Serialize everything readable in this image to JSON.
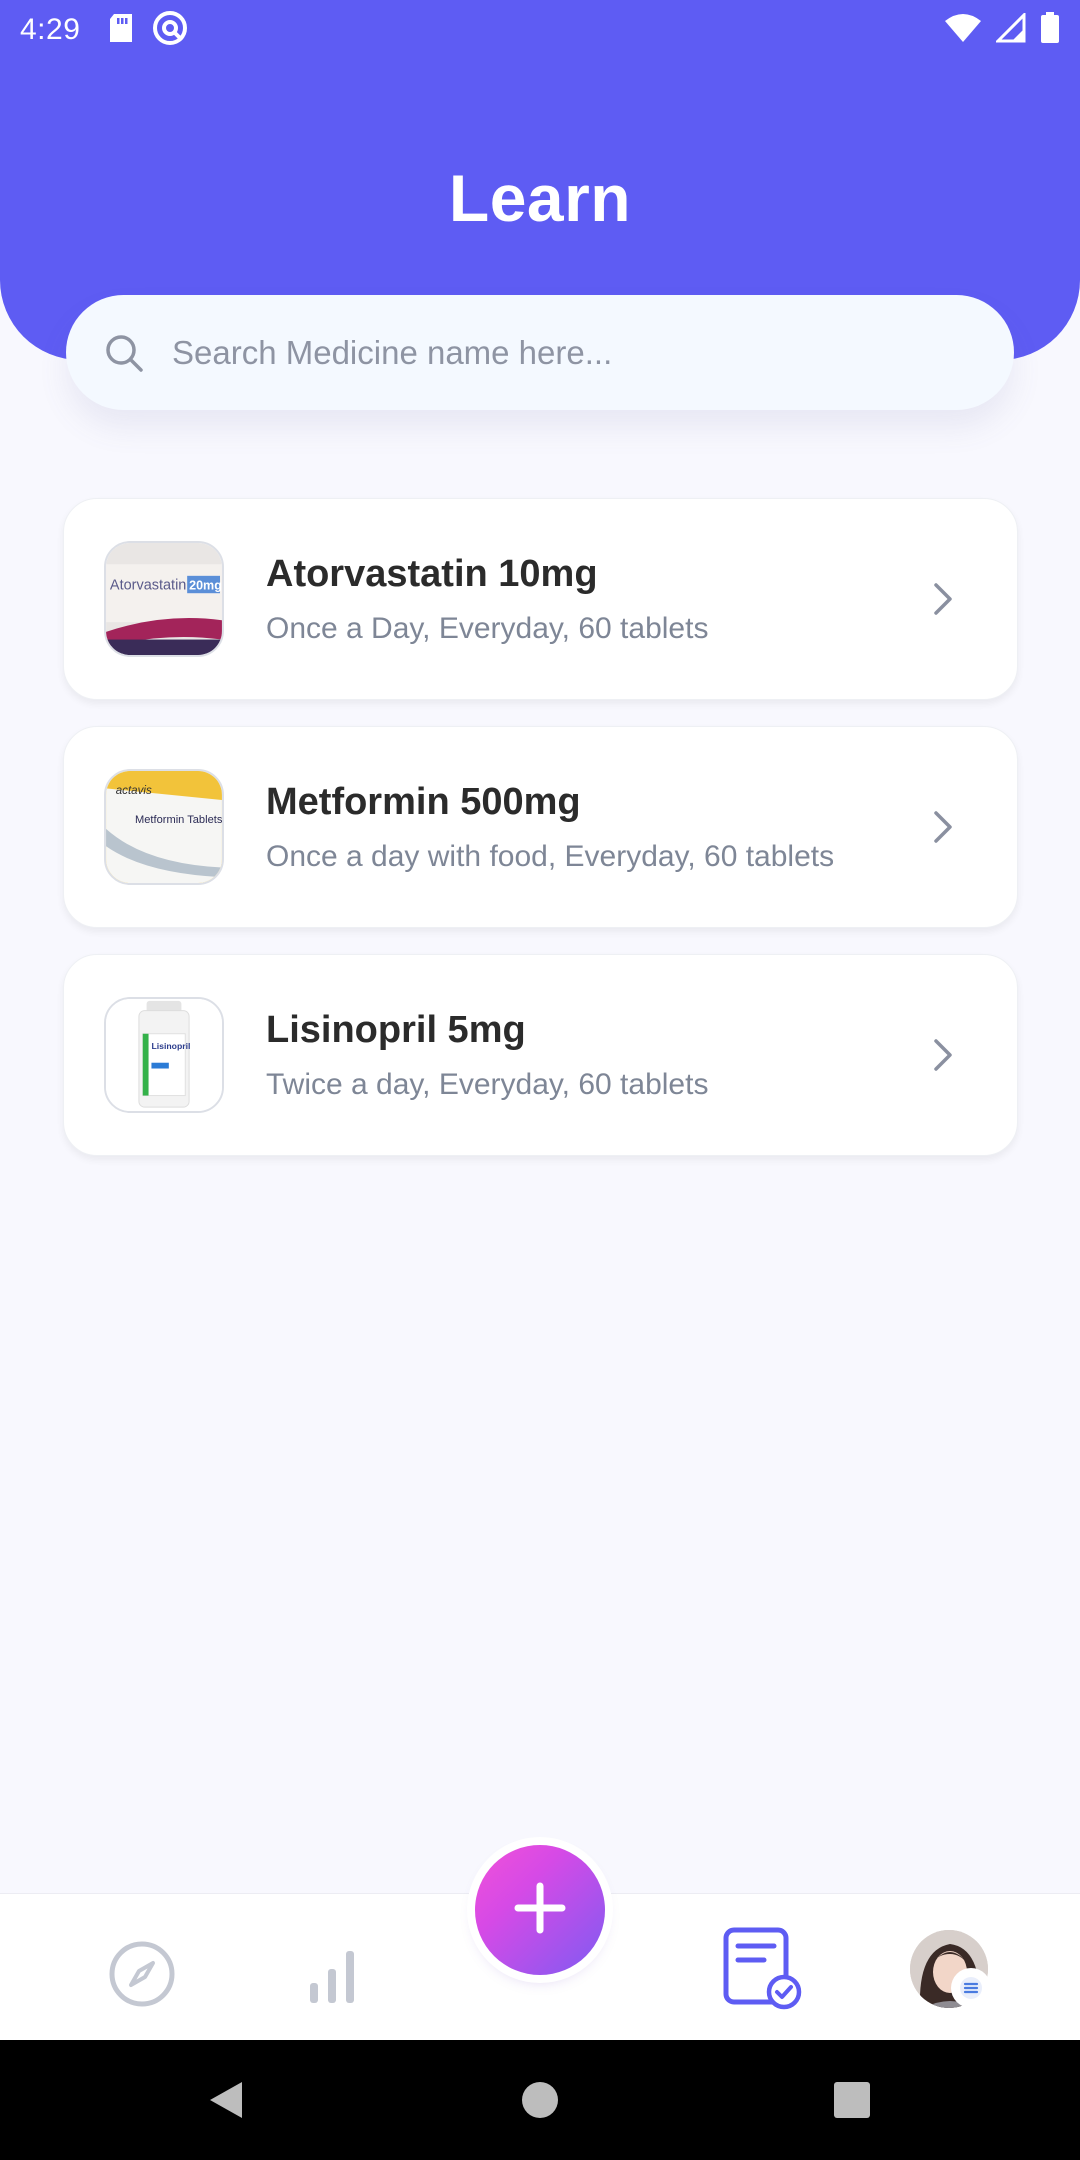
{
  "status_bar": {
    "time": "4:29",
    "icons_left": [
      "sd-card-icon",
      "do-not-disturb-icon"
    ],
    "icons_right": [
      "wifi-icon",
      "signal-icon",
      "battery-icon"
    ]
  },
  "header": {
    "title": "Learn"
  },
  "search": {
    "placeholder": "Search Medicine name here...",
    "value": "",
    "icon": "search-icon"
  },
  "medicines": [
    {
      "name": "Atorvastatin 10mg",
      "schedule": "Once a Day, Everyday, 60 tablets",
      "thumb_label": "Atorvastatin",
      "thumb_badge": "20mg"
    },
    {
      "name": "Metformin 500mg",
      "schedule": "Once a day with food, Everyday, 60 tablets",
      "thumb_label": "Metformin Tablets",
      "thumb_brand": "actavis"
    },
    {
      "name": "Lisinopril 5mg",
      "schedule": "Twice a day, Everyday, 60 tablets",
      "thumb_label": "Lisinopril"
    }
  ],
  "bottom_nav": {
    "items": [
      "compass-icon",
      "stats-icon",
      "add-icon",
      "prescription-icon",
      "avatar"
    ],
    "active": "prescription-icon"
  },
  "colors": {
    "primary": "#5E5CF3",
    "fab_start": "#F251D8",
    "fab_end": "#7E5BF2",
    "text_primary": "#2B2B2B",
    "text_secondary": "#7E8696"
  }
}
